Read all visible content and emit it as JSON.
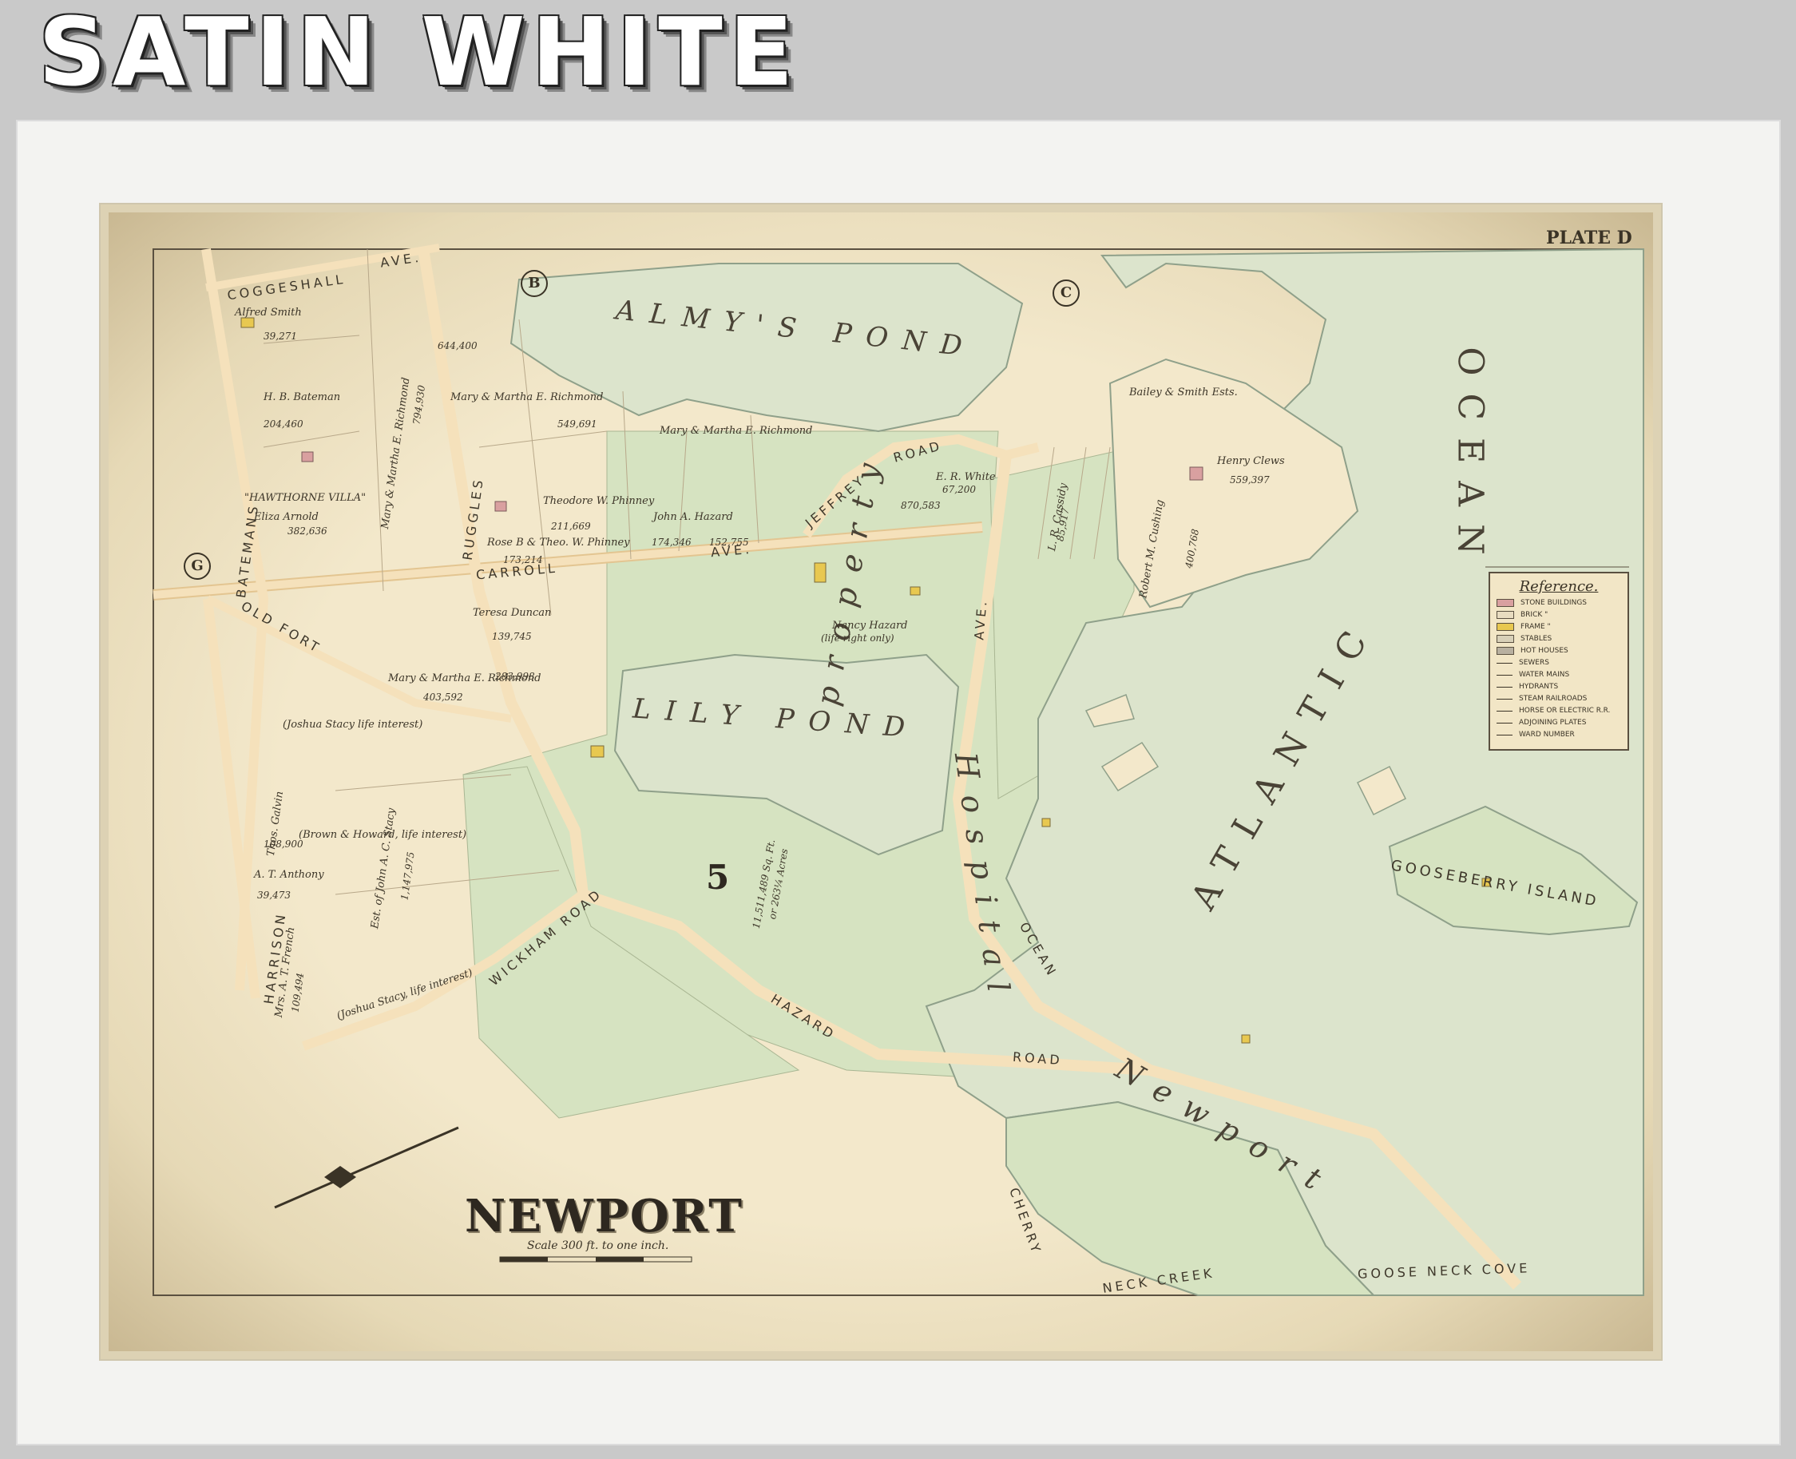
{
  "banner": {
    "title": "SATIN WHITE"
  },
  "plate": {
    "label": "PLATE D"
  },
  "map": {
    "title": "NEWPORT",
    "scale": "Scale 300 ft. to one inch.",
    "ward": "5",
    "adjoining": [
      "B",
      "C",
      "G"
    ],
    "water": {
      "almys_pond": "ALMY'S POND",
      "lily_pond": "LILY POND",
      "atlantic": "ATLANTIC",
      "ocean": "OCEAN",
      "gooseberry": "GOOSEBERRY ISLAND",
      "cherry": "CHERRY",
      "neck_creek": "NECK CREEK",
      "goose_neck": "GOOSE NECK COVE"
    },
    "roads": {
      "coggeshall": "COGGESHALL",
      "ave": "AVE.",
      "batemans": "BATEMANS",
      "ruggles": "RUGGLES",
      "carroll": "CARROLL",
      "jeffrey": "JEFFREY",
      "road": "ROAD",
      "old_fort": "OLD FORT",
      "harrison": "HARRISON",
      "wickham": "WICKHAM ROAD",
      "hazard": "HAZARD",
      "ocean_ave": "OCEAN"
    },
    "hospital_text": "Hospital",
    "property_text": "property",
    "newport_text": "Newport",
    "owners": [
      {
        "name": "Alfred Smith",
        "area": "39,271"
      },
      {
        "name": "H. B. Bateman",
        "area": "204,460"
      },
      {
        "name": "\"HAWTHORNE VILLA\"",
        "area": ""
      },
      {
        "name": "Eliza Arnold",
        "area": "382,636"
      },
      {
        "name": "Mary & Martha E. Richmond",
        "area": "794,930"
      },
      {
        "name": "Mary & Martha E. Richmond",
        "area": "549,691"
      },
      {
        "name": "",
        "area": "644,400"
      },
      {
        "name": "Mary & Martha E. Richmond",
        "area": ""
      },
      {
        "name": "Theodore W. Phinney",
        "area": "211,669"
      },
      {
        "name": "Rose B & Theo. W. Phinney",
        "area": "173,214"
      },
      {
        "name": "John A. Hazard",
        "area": "174,346"
      },
      {
        "name": "",
        "area": "152,755"
      },
      {
        "name": "E. R. White",
        "area": "67,200"
      },
      {
        "name": "",
        "area": "870,583"
      },
      {
        "name": "Henry Clews",
        "area": "559,397"
      },
      {
        "name": "Bailey & Smith Ests.",
        "area": ""
      },
      {
        "name": "Teresa Duncan",
        "area": "139,745"
      },
      {
        "name": "Nancy Hazard",
        "area": "(life right only)"
      },
      {
        "name": "Mary & Martha E. Richmond",
        "area": "403,592"
      },
      {
        "name": "",
        "area": "283,998"
      },
      {
        "name": "(Joshua Stacy life interest)",
        "area": ""
      },
      {
        "name": "(Brown & Howard, life interest)",
        "area": ""
      },
      {
        "name": "Est. of John A. C. Stacy",
        "area": "1,147,975"
      },
      {
        "name": "(Joshua Stacy, life interest)",
        "area": ""
      },
      {
        "name": "Thos. Galvin",
        "area": "108,900"
      },
      {
        "name": "A. T. Anthony",
        "area": "39,473"
      },
      {
        "name": "Mrs. A. T. French",
        "area": "109,494"
      },
      {
        "name": "L. R. Cassidy",
        "area": "85,917"
      },
      {
        "name": "Robert M. Cushing",
        "area": "400,768"
      },
      {
        "name": "",
        "area": "11,511,489 Sq. Ft."
      },
      {
        "name": "",
        "area": "or 263¼ Acres"
      }
    ]
  },
  "legend": {
    "title": "Reference.",
    "items": [
      {
        "label": "STONE BUILDINGS",
        "color": "#d9a0a0",
        "kind": "swatch"
      },
      {
        "label": "BRICK  \"",
        "color": "#e8dcc0",
        "kind": "swatch"
      },
      {
        "label": "FRAME  \"",
        "color": "#e8c850",
        "kind": "swatch"
      },
      {
        "label": "STABLES",
        "color": "#d8d0b8",
        "kind": "swatch"
      },
      {
        "label": "HOT HOUSES",
        "color": "#b8b0a0",
        "kind": "swatch"
      },
      {
        "label": "SEWERS",
        "color": "",
        "kind": "line"
      },
      {
        "label": "WATER MAINS",
        "color": "",
        "kind": "line"
      },
      {
        "label": "HYDRANTS",
        "color": "",
        "kind": "line"
      },
      {
        "label": "STEAM RAILROADS",
        "color": "",
        "kind": "line"
      },
      {
        "label": "HORSE OR ELECTRIC R.R.",
        "color": "",
        "kind": "line"
      },
      {
        "label": "ADJOINING PLATES",
        "color": "",
        "kind": "line"
      },
      {
        "label": "WARD NUMBER",
        "color": "",
        "kind": "line"
      }
    ]
  },
  "colors": {
    "paper": "#f3e8cb",
    "water": "#dce4cc",
    "green_parcel": "#d6e3c1",
    "road": "#f0d8b0",
    "ink": "#3a3326"
  }
}
